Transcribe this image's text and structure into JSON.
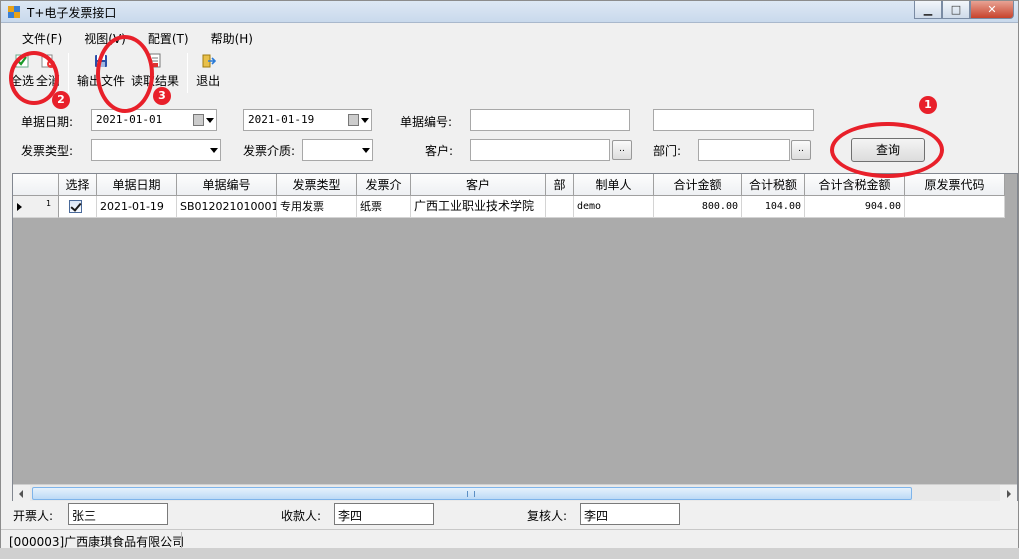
{
  "window": {
    "title": "T+电子发票接口"
  },
  "menu": [
    "文件(F)",
    "视图(V)",
    "配置(T)",
    "帮助(H)"
  ],
  "toolbar": {
    "select_all": "全选",
    "deselect_all": "全消",
    "export_file": "输出文件",
    "read_result": "读取结果",
    "exit": "退出"
  },
  "filters": {
    "doc_date_label": "单据日期:",
    "date_from": "2021-01-01",
    "date_to": "2021-01-19",
    "doc_no_label": "单据编号:",
    "doc_no_from": "",
    "doc_no_to": "",
    "invoice_type_label": "发票类型:",
    "invoice_type_value": "",
    "invoice_medium_label": "发票介质:",
    "invoice_medium_value": "",
    "customer_label": "客户:",
    "customer_value": "",
    "department_label": "部门:",
    "department_value": "",
    "dots": "..",
    "query_button": "查询"
  },
  "grid": {
    "columns": [
      "选择",
      "单据日期",
      "单据编号",
      "发票类型",
      "发票介",
      "客户",
      "部",
      "制单人",
      "合计金额",
      "合计税额",
      "合计含税金额",
      "原发票代码"
    ],
    "rows": [
      {
        "row_number": "1",
        "selected": true,
        "doc_date": "2021-01-19",
        "doc_no": "SB012021010001",
        "invoice_type": "专用发票",
        "invoice_medium": "纸票",
        "customer": "广西工业职业技术学院",
        "department": "",
        "creator": "demo",
        "total_amount": "800.00",
        "total_tax": "104.00",
        "total_with_tax": "904.00",
        "original_invoice_code": ""
      }
    ]
  },
  "footer": {
    "drawer_label": "开票人:",
    "drawer_value": "张三",
    "payee_label": "收款人:",
    "payee_value": "李四",
    "reviewer_label": "复核人:",
    "reviewer_value": "李四"
  },
  "status": {
    "company": "[000003]广西康琪食品有限公司"
  },
  "annotations": {
    "badge1": "1",
    "badge2": "2",
    "badge3": "3",
    "color": "#e8202a"
  }
}
